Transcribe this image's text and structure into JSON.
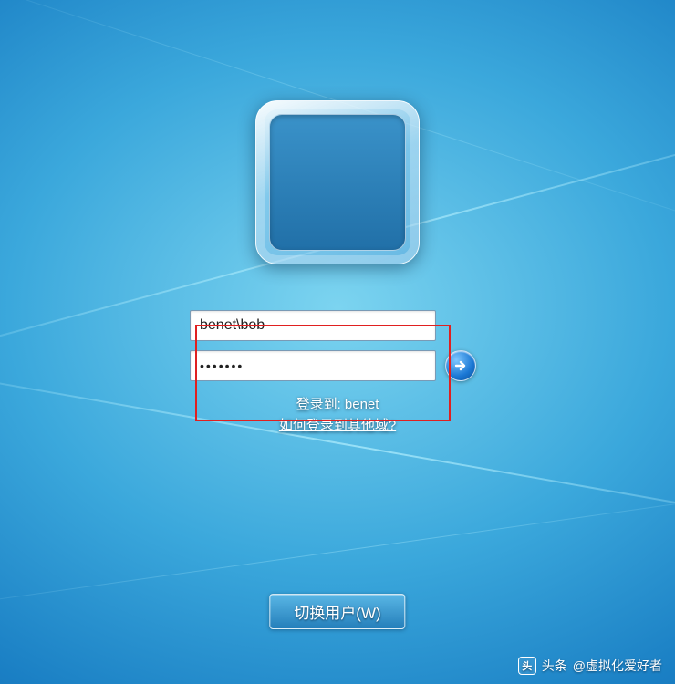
{
  "login": {
    "username_value": "benet\\bob",
    "password_value": "•••••••",
    "domain_label": "登录到: benet",
    "other_domain_link": "如何登录到其他域?"
  },
  "switch_user_label": "切换用户(W)",
  "watermark": {
    "prefix": "头条",
    "handle": "@虚拟化爱好者"
  }
}
